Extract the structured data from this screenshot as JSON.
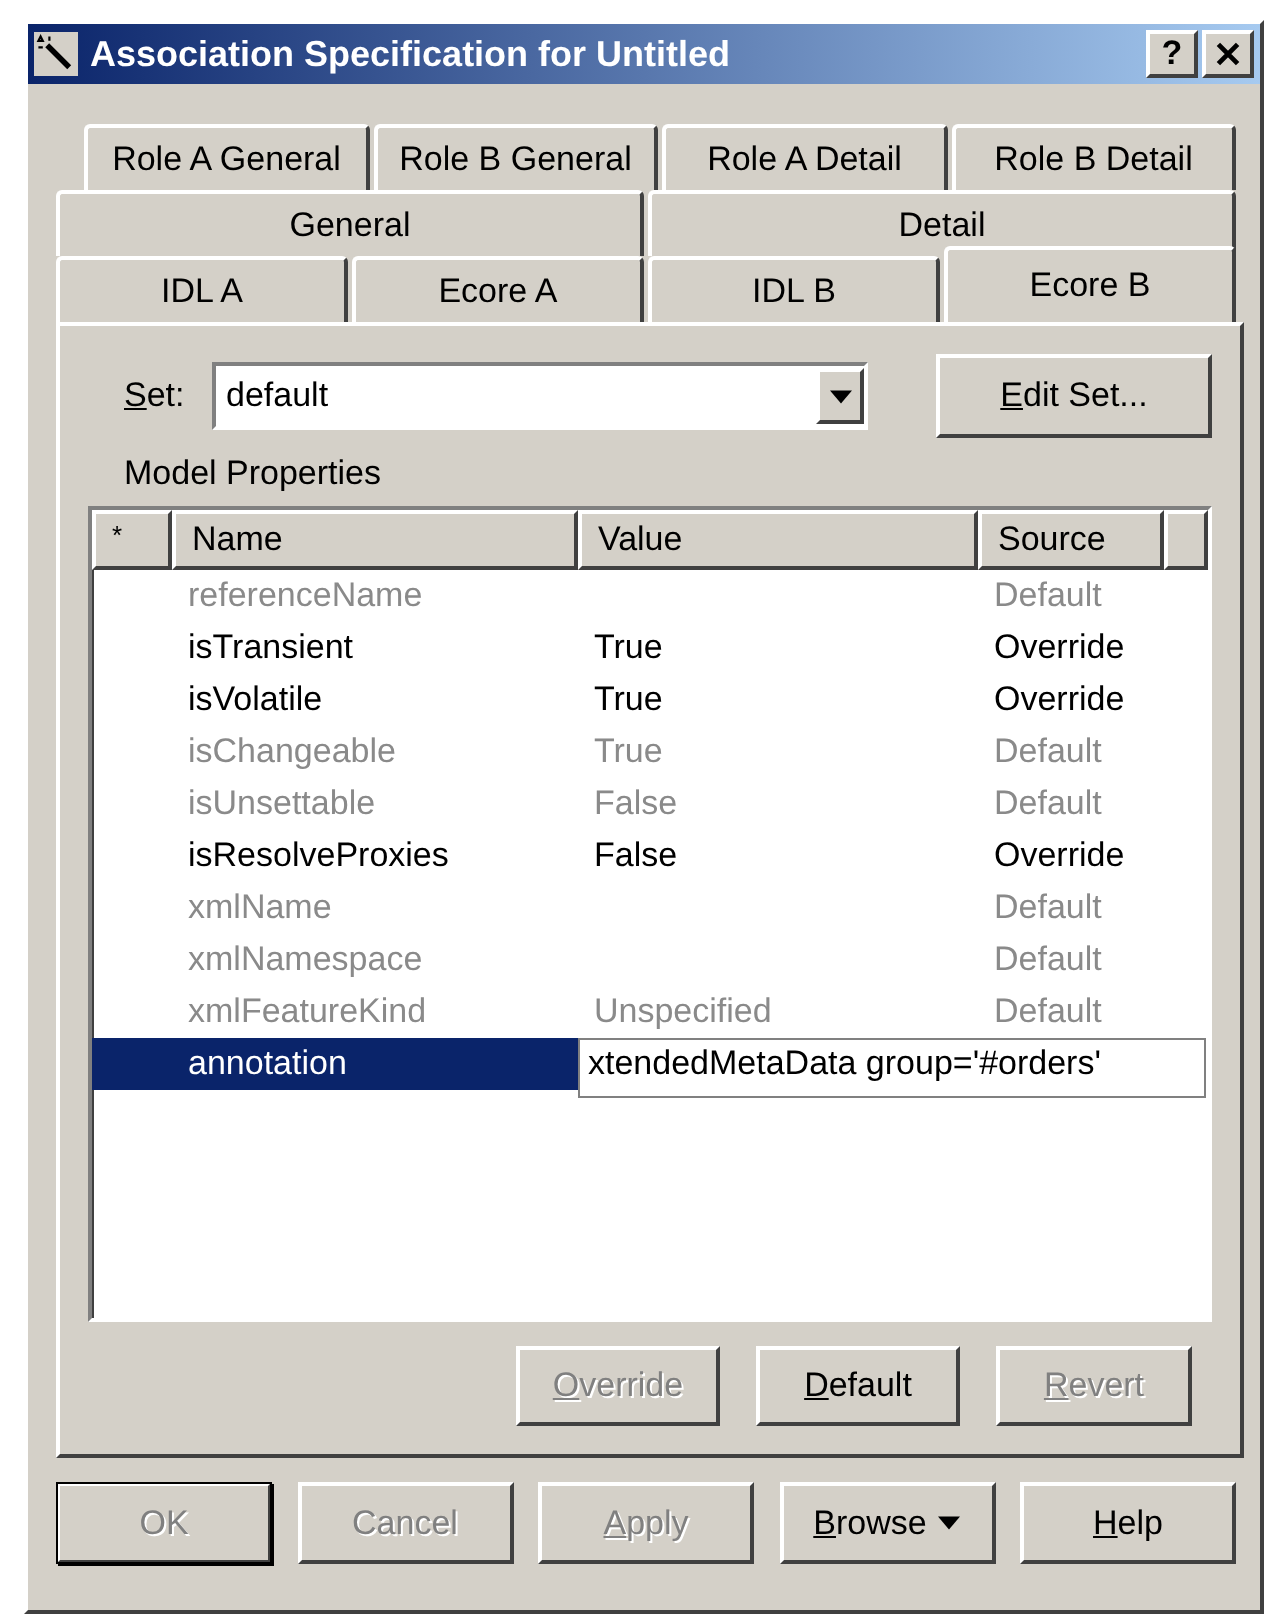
{
  "window": {
    "title": "Association Specification for Untitled",
    "help_button": "?"
  },
  "tab_rows": [
    [
      {
        "label": "Role A General",
        "selected": false
      },
      {
        "label": "Role B General",
        "selected": false
      },
      {
        "label": "Role A Detail",
        "selected": false
      },
      {
        "label": "Role B Detail",
        "selected": false
      }
    ],
    [
      {
        "label": "General",
        "selected": false
      },
      {
        "label": "Detail",
        "selected": false
      }
    ],
    [
      {
        "label": "IDL A",
        "selected": false
      },
      {
        "label": "Ecore A",
        "selected": false
      },
      {
        "label": "IDL B",
        "selected": false
      },
      {
        "label": "Ecore B",
        "selected": true
      }
    ]
  ],
  "set": {
    "label": "Set:",
    "mnemonic": true,
    "value": "default"
  },
  "edit_set_button": {
    "label": "Edit Set...",
    "mnemonic": true
  },
  "model_properties": {
    "label": "Model Properties"
  },
  "table": {
    "columns": [
      "*",
      "Name",
      "Value",
      "Source"
    ],
    "rows": [
      {
        "name": "referenceName",
        "source": "Default",
        "dimmed": true,
        "selected": false
      },
      {
        "name": "isTransient",
        "value": "True",
        "source": "Override",
        "dimmed": false,
        "selected": false
      },
      {
        "name": "isVolatile",
        "value": "True",
        "source": "Override",
        "dimmed": false,
        "selected": false
      },
      {
        "name": "isChangeable",
        "value": "True",
        "source": "Default",
        "dimmed": true,
        "selected": false
      },
      {
        "name": "isUnsettable",
        "value": "False",
        "source": "Default",
        "dimmed": true,
        "selected": false
      },
      {
        "name": "isResolveProxies",
        "value": "False",
        "source": "Override",
        "dimmed": false,
        "selected": false
      },
      {
        "name": "xmlName",
        "source": "Default",
        "dimmed": true,
        "selected": false
      },
      {
        "name": "xmlNamespace",
        "source": "Default",
        "dimmed": true,
        "selected": false
      },
      {
        "name": "xmlFeatureKind",
        "value": "Unspecified",
        "source": "Default",
        "dimmed": true,
        "selected": false
      },
      {
        "name": "annotation",
        "value": "xtendedMetaData group='#orders'",
        "dimmed": false,
        "selected": true
      }
    ]
  },
  "property_buttons": [
    {
      "label": "Override",
      "mnemonic": true,
      "disabled": true
    },
    {
      "label": "Default",
      "mnemonic": true,
      "disabled": false
    },
    {
      "label": "Revert",
      "mnemonic": true,
      "disabled": true
    }
  ],
  "dialog_buttons": [
    {
      "label": "OK",
      "mnemonic": false,
      "disabled": true,
      "default": true,
      "kind": "plain"
    },
    {
      "label": "Cancel",
      "mnemonic": false,
      "disabled": true,
      "default": false,
      "kind": "plain"
    },
    {
      "label": "Apply",
      "mnemonic": true,
      "disabled": true,
      "default": false,
      "kind": "plain"
    },
    {
      "label": "Browse",
      "mnemonic": true,
      "disabled": false,
      "default": false,
      "kind": "dropdown"
    },
    {
      "label": "Help",
      "mnemonic": true,
      "disabled": false,
      "default": false,
      "kind": "plain"
    }
  ]
}
